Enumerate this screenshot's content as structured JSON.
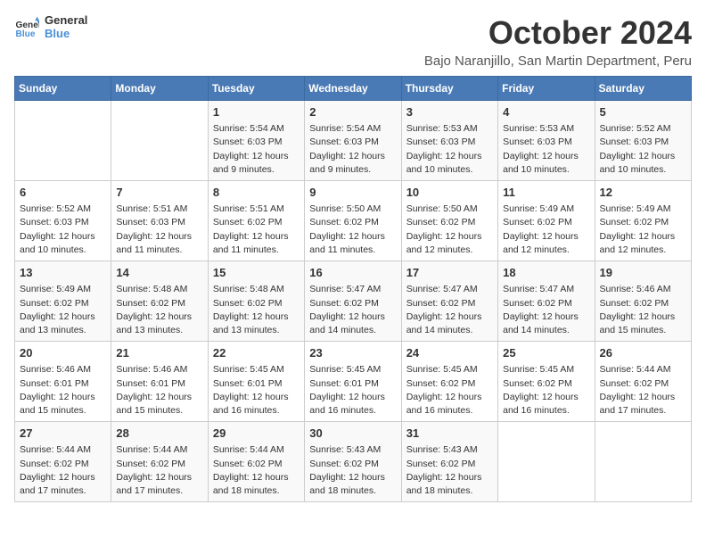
{
  "logo": {
    "line1": "General",
    "line2": "Blue",
    "icon_color": "#4a90d9"
  },
  "title": "October 2024",
  "subtitle": "Bajo Naranjillo, San Martin Department, Peru",
  "days_of_week": [
    "Sunday",
    "Monday",
    "Tuesday",
    "Wednesday",
    "Thursday",
    "Friday",
    "Saturday"
  ],
  "weeks": [
    [
      {
        "day": "",
        "info": ""
      },
      {
        "day": "",
        "info": ""
      },
      {
        "day": "1",
        "info": "Sunrise: 5:54 AM\nSunset: 6:03 PM\nDaylight: 12 hours and 9 minutes."
      },
      {
        "day": "2",
        "info": "Sunrise: 5:54 AM\nSunset: 6:03 PM\nDaylight: 12 hours and 9 minutes."
      },
      {
        "day": "3",
        "info": "Sunrise: 5:53 AM\nSunset: 6:03 PM\nDaylight: 12 hours and 10 minutes."
      },
      {
        "day": "4",
        "info": "Sunrise: 5:53 AM\nSunset: 6:03 PM\nDaylight: 12 hours and 10 minutes."
      },
      {
        "day": "5",
        "info": "Sunrise: 5:52 AM\nSunset: 6:03 PM\nDaylight: 12 hours and 10 minutes."
      }
    ],
    [
      {
        "day": "6",
        "info": "Sunrise: 5:52 AM\nSunset: 6:03 PM\nDaylight: 12 hours and 10 minutes."
      },
      {
        "day": "7",
        "info": "Sunrise: 5:51 AM\nSunset: 6:03 PM\nDaylight: 12 hours and 11 minutes."
      },
      {
        "day": "8",
        "info": "Sunrise: 5:51 AM\nSunset: 6:02 PM\nDaylight: 12 hours and 11 minutes."
      },
      {
        "day": "9",
        "info": "Sunrise: 5:50 AM\nSunset: 6:02 PM\nDaylight: 12 hours and 11 minutes."
      },
      {
        "day": "10",
        "info": "Sunrise: 5:50 AM\nSunset: 6:02 PM\nDaylight: 12 hours and 12 minutes."
      },
      {
        "day": "11",
        "info": "Sunrise: 5:49 AM\nSunset: 6:02 PM\nDaylight: 12 hours and 12 minutes."
      },
      {
        "day": "12",
        "info": "Sunrise: 5:49 AM\nSunset: 6:02 PM\nDaylight: 12 hours and 12 minutes."
      }
    ],
    [
      {
        "day": "13",
        "info": "Sunrise: 5:49 AM\nSunset: 6:02 PM\nDaylight: 12 hours and 13 minutes."
      },
      {
        "day": "14",
        "info": "Sunrise: 5:48 AM\nSunset: 6:02 PM\nDaylight: 12 hours and 13 minutes."
      },
      {
        "day": "15",
        "info": "Sunrise: 5:48 AM\nSunset: 6:02 PM\nDaylight: 12 hours and 13 minutes."
      },
      {
        "day": "16",
        "info": "Sunrise: 5:47 AM\nSunset: 6:02 PM\nDaylight: 12 hours and 14 minutes."
      },
      {
        "day": "17",
        "info": "Sunrise: 5:47 AM\nSunset: 6:02 PM\nDaylight: 12 hours and 14 minutes."
      },
      {
        "day": "18",
        "info": "Sunrise: 5:47 AM\nSunset: 6:02 PM\nDaylight: 12 hours and 14 minutes."
      },
      {
        "day": "19",
        "info": "Sunrise: 5:46 AM\nSunset: 6:02 PM\nDaylight: 12 hours and 15 minutes."
      }
    ],
    [
      {
        "day": "20",
        "info": "Sunrise: 5:46 AM\nSunset: 6:01 PM\nDaylight: 12 hours and 15 minutes."
      },
      {
        "day": "21",
        "info": "Sunrise: 5:46 AM\nSunset: 6:01 PM\nDaylight: 12 hours and 15 minutes."
      },
      {
        "day": "22",
        "info": "Sunrise: 5:45 AM\nSunset: 6:01 PM\nDaylight: 12 hours and 16 minutes."
      },
      {
        "day": "23",
        "info": "Sunrise: 5:45 AM\nSunset: 6:01 PM\nDaylight: 12 hours and 16 minutes."
      },
      {
        "day": "24",
        "info": "Sunrise: 5:45 AM\nSunset: 6:02 PM\nDaylight: 12 hours and 16 minutes."
      },
      {
        "day": "25",
        "info": "Sunrise: 5:45 AM\nSunset: 6:02 PM\nDaylight: 12 hours and 16 minutes."
      },
      {
        "day": "26",
        "info": "Sunrise: 5:44 AM\nSunset: 6:02 PM\nDaylight: 12 hours and 17 minutes."
      }
    ],
    [
      {
        "day": "27",
        "info": "Sunrise: 5:44 AM\nSunset: 6:02 PM\nDaylight: 12 hours and 17 minutes."
      },
      {
        "day": "28",
        "info": "Sunrise: 5:44 AM\nSunset: 6:02 PM\nDaylight: 12 hours and 17 minutes."
      },
      {
        "day": "29",
        "info": "Sunrise: 5:44 AM\nSunset: 6:02 PM\nDaylight: 12 hours and 18 minutes."
      },
      {
        "day": "30",
        "info": "Sunrise: 5:43 AM\nSunset: 6:02 PM\nDaylight: 12 hours and 18 minutes."
      },
      {
        "day": "31",
        "info": "Sunrise: 5:43 AM\nSunset: 6:02 PM\nDaylight: 12 hours and 18 minutes."
      },
      {
        "day": "",
        "info": ""
      },
      {
        "day": "",
        "info": ""
      }
    ]
  ]
}
